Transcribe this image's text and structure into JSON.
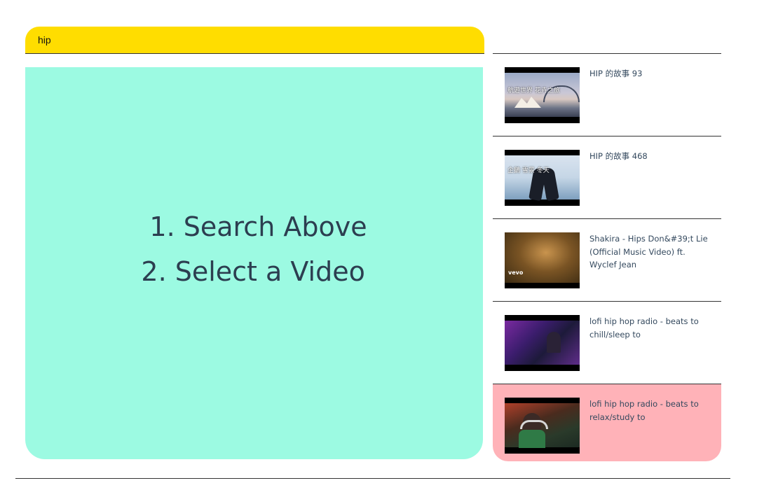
{
  "search": {
    "value": "hip",
    "placeholder": ""
  },
  "player": {
    "instruction_1": "1. Search Above",
    "instruction_2": "2. Select a Video"
  },
  "videos": [
    {
      "title": "HIP 的故事 93",
      "thumb_caption": "航遊世界 花卉之旅",
      "selected": false
    },
    {
      "title": "HIP 的故事 468",
      "thumb_caption": "企鵝 雪景 冬天",
      "selected": false
    },
    {
      "title": "Shakira - Hips Don&#39;t Lie (Official Music Video) ft. Wyclef Jean",
      "thumb_caption": "vevo",
      "selected": false
    },
    {
      "title": "lofi hip hop radio - beats to chill/sleep to",
      "thumb_caption": "",
      "selected": false
    },
    {
      "title": "lofi hip hop radio - beats to relax/study to",
      "thumb_caption": "",
      "selected": true
    }
  ],
  "colors": {
    "search_bar": "#ffdd00",
    "player_bg": "#9cfae2",
    "selected_item": "#ffb2b8",
    "text": "#2c3e50"
  }
}
